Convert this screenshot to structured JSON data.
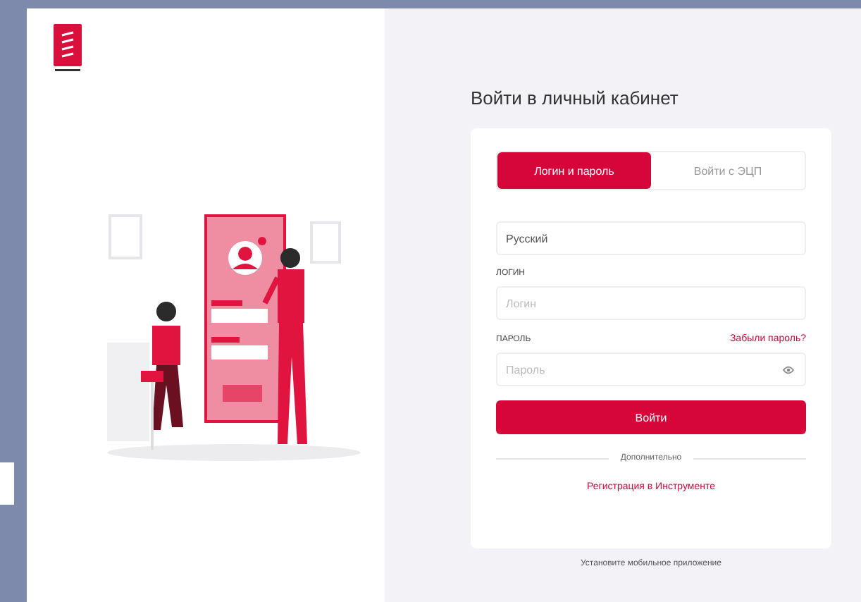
{
  "title": "Войти в личный кабинет",
  "tabs": [
    {
      "label": "Логин и пароль",
      "selected": true
    },
    {
      "label": "Войти с ЭЦП",
      "selected": false
    }
  ],
  "language": {
    "value": "Русский"
  },
  "login": {
    "label": "ЛОГИН",
    "placeholder": "Логин"
  },
  "password": {
    "label": "ПАРОЛЬ",
    "placeholder": "Пароль",
    "forgot": "Забыли пароль?"
  },
  "submit": "Войти",
  "divider": "Дополнительно",
  "register": "Регистрация в Инструменте",
  "footer": "Установите мобильное приложение"
}
